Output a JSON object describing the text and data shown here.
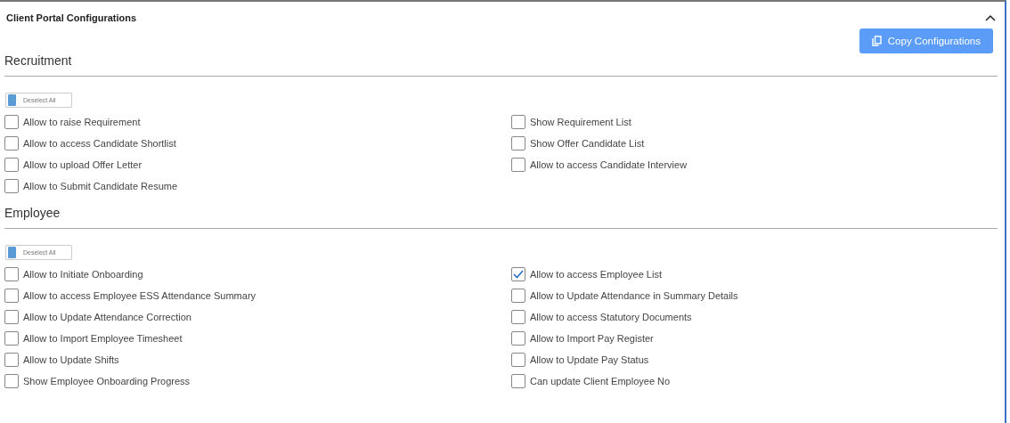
{
  "panel": {
    "title": "Client Portal Configurations",
    "expanded": true,
    "copy_button": "Copy Configurations"
  },
  "sections": [
    {
      "title": "Recruitment",
      "toggle": {
        "label": "Deselect All"
      },
      "options": [
        {
          "label": "Allow to raise Requirement",
          "checked": false
        },
        {
          "label": "Show Requirement List",
          "checked": false
        },
        {
          "label": "Allow to access Candidate Shortlist",
          "checked": false
        },
        {
          "label": "Show Offer Candidate List",
          "checked": false
        },
        {
          "label": "Allow to upload Offer Letter",
          "checked": false
        },
        {
          "label": "Allow to access Candidate Interview",
          "checked": false
        },
        {
          "label": "Allow to Submit Candidate Resume",
          "checked": false
        }
      ]
    },
    {
      "title": "Employee",
      "toggle": {
        "label": "Deselect All"
      },
      "options": [
        {
          "label": "Allow to Initiate Onboarding",
          "checked": false
        },
        {
          "label": "Allow to access Employee List",
          "checked": true
        },
        {
          "label": "Allow to access Employee ESS Attendance Summary",
          "checked": false
        },
        {
          "label": "Allow to Update Attendance in Summary Details",
          "checked": false
        },
        {
          "label": "Allow to Update Attendance Correction",
          "checked": false
        },
        {
          "label": "Allow to access Statutory Documents",
          "checked": false
        },
        {
          "label": "Allow to Import Employee Timesheet",
          "checked": false
        },
        {
          "label": "Allow to Import Pay Register",
          "checked": false
        },
        {
          "label": "Allow to Update Shifts",
          "checked": false
        },
        {
          "label": "Allow to Update Pay Status",
          "checked": false
        },
        {
          "label": "Show Employee Onboarding Progress",
          "checked": false
        },
        {
          "label": "Can update Client Employee No",
          "checked": false
        }
      ]
    }
  ]
}
